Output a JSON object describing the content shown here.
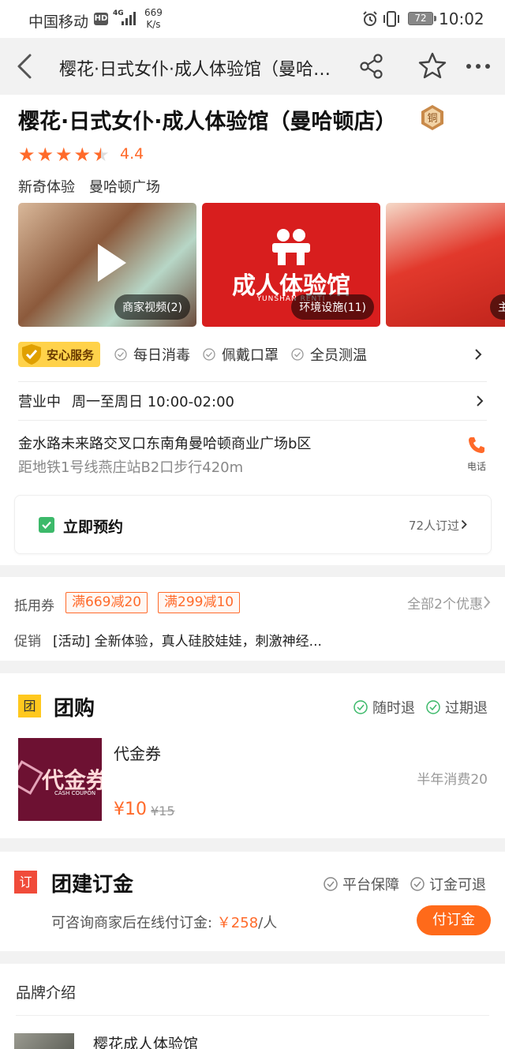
{
  "status_bar": {
    "carrier": "中国移动",
    "hd": "HD",
    "network": "4G",
    "speed_value": "669",
    "speed_unit": "K/s",
    "battery": "72",
    "time": "10:02"
  },
  "nav": {
    "title": "樱花·日式女仆·成人体验馆（曼哈顿店）"
  },
  "shop": {
    "name": "樱花·日式女仆·成人体验馆（曼哈顿店）",
    "medal": "铜",
    "rating": "4.4",
    "rating_value": 4.4,
    "tags": [
      "新奇体验",
      "曼哈顿广场"
    ],
    "photos": [
      {
        "label": "商家视频(2)"
      },
      {
        "label": "环境设施(11)",
        "logo_text": "成人体验馆",
        "logo_sub": "YUNSHAN RENTI"
      },
      {
        "label": "主营"
      }
    ],
    "safe_service": {
      "label": "安心服务",
      "items": [
        "每日消毒",
        "佩戴口罩",
        "全员测温"
      ]
    },
    "hours_status": "营业中",
    "hours_days": "周一至周日",
    "hours_time": "10:00-02:00",
    "address": "金水路未来路交叉口东南角曼哈顿商业广场b区",
    "distance": "距地铁1号线燕庄站B2口步行420m",
    "phone_label": "电话",
    "booking": {
      "label": "立即预约",
      "count": "72人订过"
    }
  },
  "discounts": {
    "voucher_label": "抵用券",
    "coupons": [
      "满669减20",
      "满299减10"
    ],
    "all_label": "全部2个优惠",
    "promo_label": "促销",
    "promo_text": "[活动] 全新体验，真人硅胶娃娃，刺激神经..."
  },
  "group_buy": {
    "icon_char": "团",
    "title": "团购",
    "badges": [
      "随时退",
      "过期退"
    ],
    "deal": {
      "image_text": "代金券",
      "image_sub": "CASH COUPON",
      "name": "代金券",
      "sales": "半年消费20",
      "price": "¥10",
      "original": "¥15"
    }
  },
  "team_deposit": {
    "icon_char": "订",
    "title": "团建订金",
    "badges": [
      "平台保障",
      "订金可退"
    ],
    "desc_prefix": "可咨询商家后在线付订金: ",
    "desc_price": "￥258",
    "desc_suffix": "/人",
    "button": "付订金"
  },
  "brand": {
    "title": "品牌介绍",
    "name": "樱花成人体验馆"
  },
  "colors": {
    "accent": "#ff6a2a",
    "group_icon": "#ffc81e",
    "deposit_icon": "#f04b3a",
    "check_green": "#3cb96a"
  }
}
